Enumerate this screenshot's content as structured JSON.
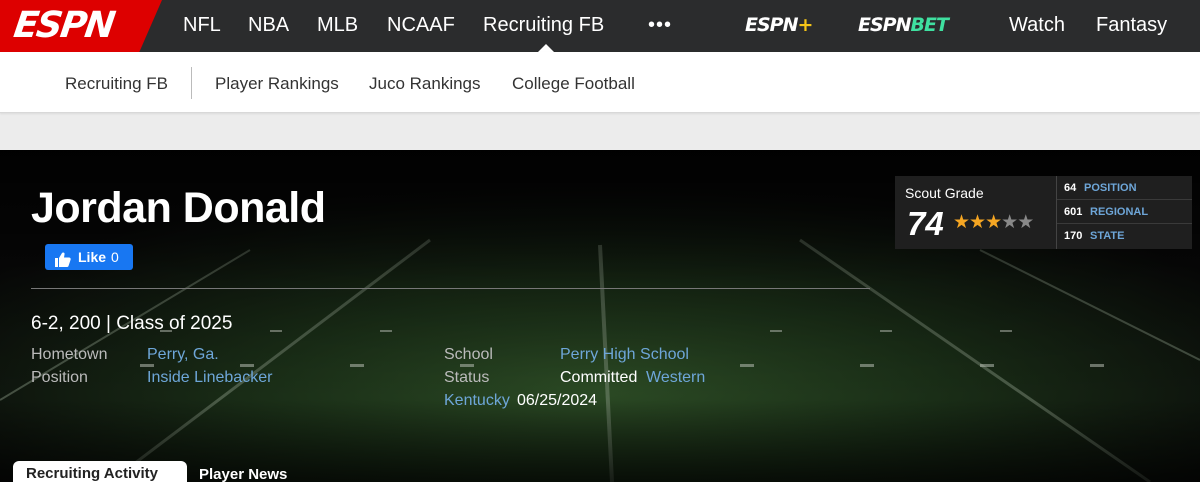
{
  "topnav": {
    "logo": "ESPN",
    "items": [
      "NFL",
      "NBA",
      "MLB",
      "NCAAF",
      "Recruiting FB"
    ],
    "more": "•••",
    "brand_plus": {
      "text": "ESPN",
      "suffix": "+"
    },
    "brand_bet": {
      "text": "ESPN",
      "suffix": "BET"
    },
    "watch": "Watch",
    "fantasy": "Fantasy"
  },
  "subnav": {
    "items": [
      "Recruiting FB",
      "Player Rankings",
      "Juco Rankings",
      "College Football"
    ]
  },
  "player": {
    "name": "Jordan Donald",
    "like_label": "Like",
    "like_count": "0",
    "bio": "6-2, 200 | Class of 2025",
    "hometown_label": "Hometown",
    "hometown": "Perry, Ga.",
    "position_label": "Position",
    "position": "Inside Linebacker",
    "school_label": "School",
    "school": "Perry High School",
    "status_label": "Status",
    "status_value": "Committed",
    "status_school_part1": "Western",
    "status_school_part2": "Kentucky",
    "status_date": "06/25/2024"
  },
  "scout": {
    "title": "Scout Grade",
    "grade": "74",
    "stars": 3,
    "stars_max": 5,
    "ranks": [
      {
        "num": "64",
        "label": "POSITION"
      },
      {
        "num": "601",
        "label": "REGIONAL"
      },
      {
        "num": "170",
        "label": "STATE"
      }
    ]
  },
  "tabs": [
    "Recruiting Activity",
    "Player News"
  ],
  "colors": {
    "espn_red": "#d00000",
    "nav_bg": "#2b2c2d",
    "link_blue": "#6ea6d8",
    "star": "#f5a623",
    "facebook": "#1877f2"
  },
  "icons": {
    "like": "thumbs-up-icon",
    "more": "more-dots-icon"
  }
}
